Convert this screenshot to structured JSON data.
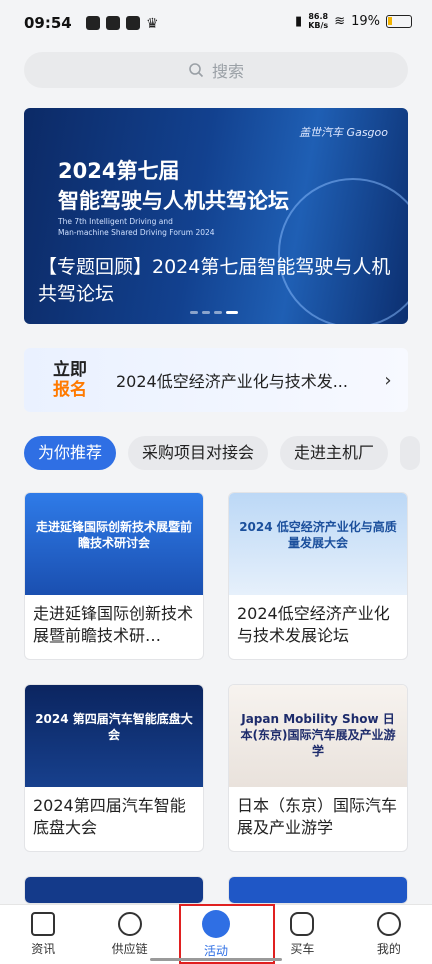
{
  "status": {
    "time": "09:54",
    "net_value": "86.8",
    "net_unit": "KB/s",
    "battery": "19%"
  },
  "search": {
    "placeholder": "搜索"
  },
  "banner": {
    "logo": "盖世汽车 Gasgoo",
    "headline_line1": "2024第七届",
    "headline_line2": "智能驾驶与人机共驾论坛",
    "subtitle_en_line1": "The 7th Intelligent Driving and",
    "subtitle_en_line2": "Man-machine Shared Driving Forum 2024",
    "caption": "【专题回顾】2024第七届智能驾驶与人机共驾论坛"
  },
  "promo": {
    "tag_line1": "立即",
    "tag_line2": "报名",
    "text": "2024低空经济产业化与技术发...",
    "arrow": "›"
  },
  "chips": [
    {
      "label": "为你推荐",
      "active": true
    },
    {
      "label": "采购项目对接会",
      "active": false
    },
    {
      "label": "走进主机厂",
      "active": false
    }
  ],
  "cards": [
    {
      "title": "走进延锋国际创新技术展暨前瞻技术研…",
      "img_text": "走进延锋国际创新技术展暨前瞻技术研讨会",
      "bg": "#2a6fd6"
    },
    {
      "title": "2024低空经济产业化与技术发展论坛",
      "img_text": "2024 低空经济产业化与高质量发展大会",
      "bg": "#cfe2f8"
    },
    {
      "title": "2024第四届汽车智能底盘大会",
      "img_text": "2024 第四届汽车智能底盘大会",
      "bg": "#0d2a66"
    },
    {
      "title": "日本（东京）国际汽车展及产业游学",
      "img_text": "Japan Mobility Show 日本(东京)国际汽车展及产业游学",
      "bg": "#f4f1ee"
    }
  ],
  "nav": [
    {
      "label": "资讯",
      "icon": "news-icon"
    },
    {
      "label": "供应链",
      "icon": "supply-chain-icon"
    },
    {
      "label": "活动",
      "icon": "activity-icon",
      "active": true
    },
    {
      "label": "买车",
      "icon": "car-icon"
    },
    {
      "label": "我的",
      "icon": "profile-icon"
    }
  ]
}
